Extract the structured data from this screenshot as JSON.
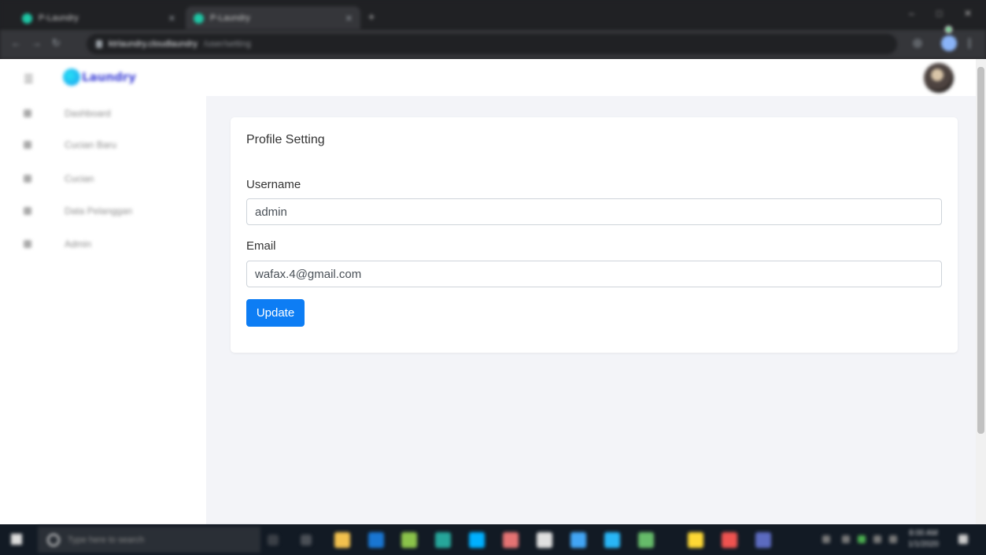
{
  "browser": {
    "tabs": [
      {
        "title": "P-Laundry",
        "active": false
      },
      {
        "title": "P-Laundry",
        "active": true
      }
    ],
    "new_tab": "+",
    "url": "ktrlaundry.cloudlaundry",
    "path": "/user/setting",
    "window_controls": [
      "–",
      "□",
      "✕"
    ]
  },
  "header": {
    "brand_name": "Laundry",
    "menu_icon": "hamburger-icon"
  },
  "sidebar": {
    "items": [
      {
        "label": "Dashboard",
        "icon": "home-icon"
      },
      {
        "label": "Cucian Baru",
        "icon": "basket-icon"
      },
      {
        "label": "Cucian",
        "icon": "list-icon"
      },
      {
        "label": "Data Pelanggan",
        "icon": "users-icon"
      },
      {
        "label": "Admin",
        "icon": "user-icon"
      }
    ]
  },
  "profile": {
    "title": "Profile Setting",
    "username_label": "Username",
    "username_value": "admin",
    "email_label": "Email",
    "email_value": "wafax.4@gmail.com",
    "update_label": "Update"
  },
  "taskbar": {
    "search_placeholder": "Type here to search",
    "time": "8:00 AM",
    "date": "1/1/2020"
  },
  "colors": {
    "primary": "#0d7df4",
    "brand": "#3b3fd6",
    "main_bg": "#f3f4f8"
  }
}
